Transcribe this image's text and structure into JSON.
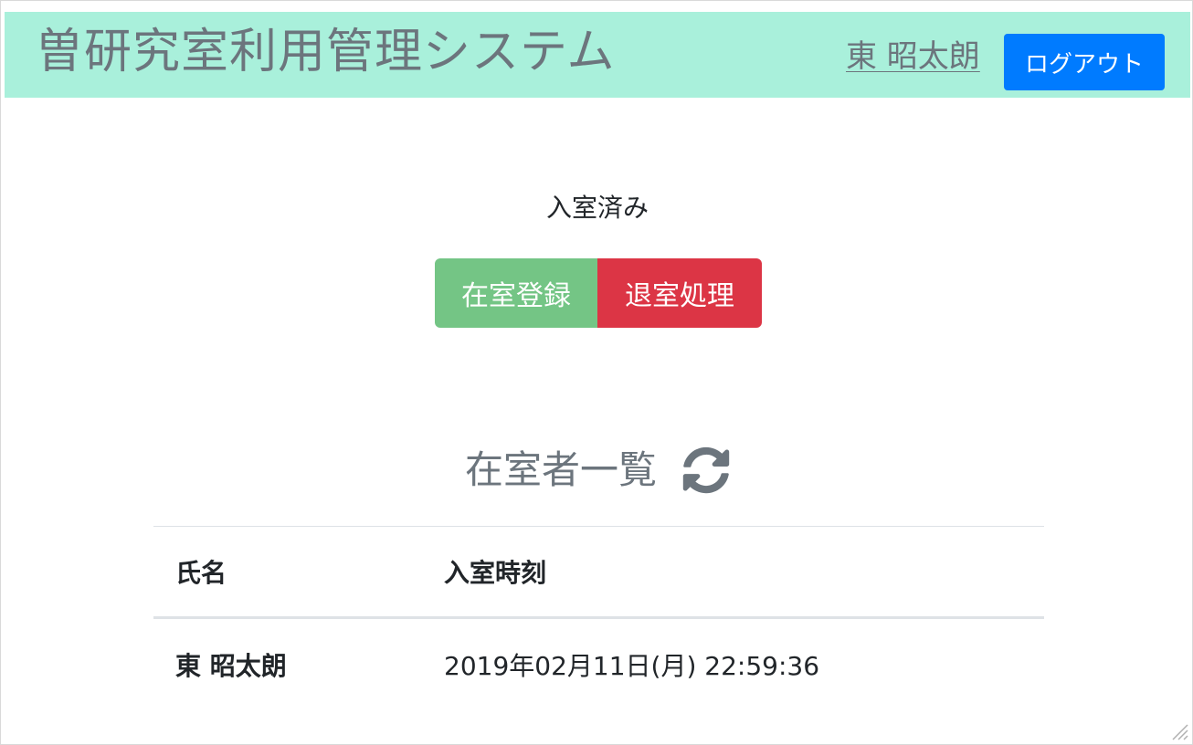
{
  "colors": {
    "header_bg": "#a9f0db",
    "primary": "#007bff",
    "success": "#74c585",
    "danger": "#dc3545",
    "muted_text": "#6c757d"
  },
  "header": {
    "title": "曽研究室利用管理システム",
    "user_name": "東 昭太朗",
    "logout_label": "ログアウト"
  },
  "status": {
    "text": "入室済み"
  },
  "actions": {
    "enter_label": "在室登録",
    "exit_label": "退室処理"
  },
  "occupants": {
    "title": "在室者一覧",
    "refresh_icon": "refresh-icon",
    "columns": [
      "氏名",
      "入室時刻"
    ],
    "rows": [
      {
        "name": "東 昭太朗",
        "time": "2019年02月11日(月) 22:59:36"
      }
    ]
  }
}
